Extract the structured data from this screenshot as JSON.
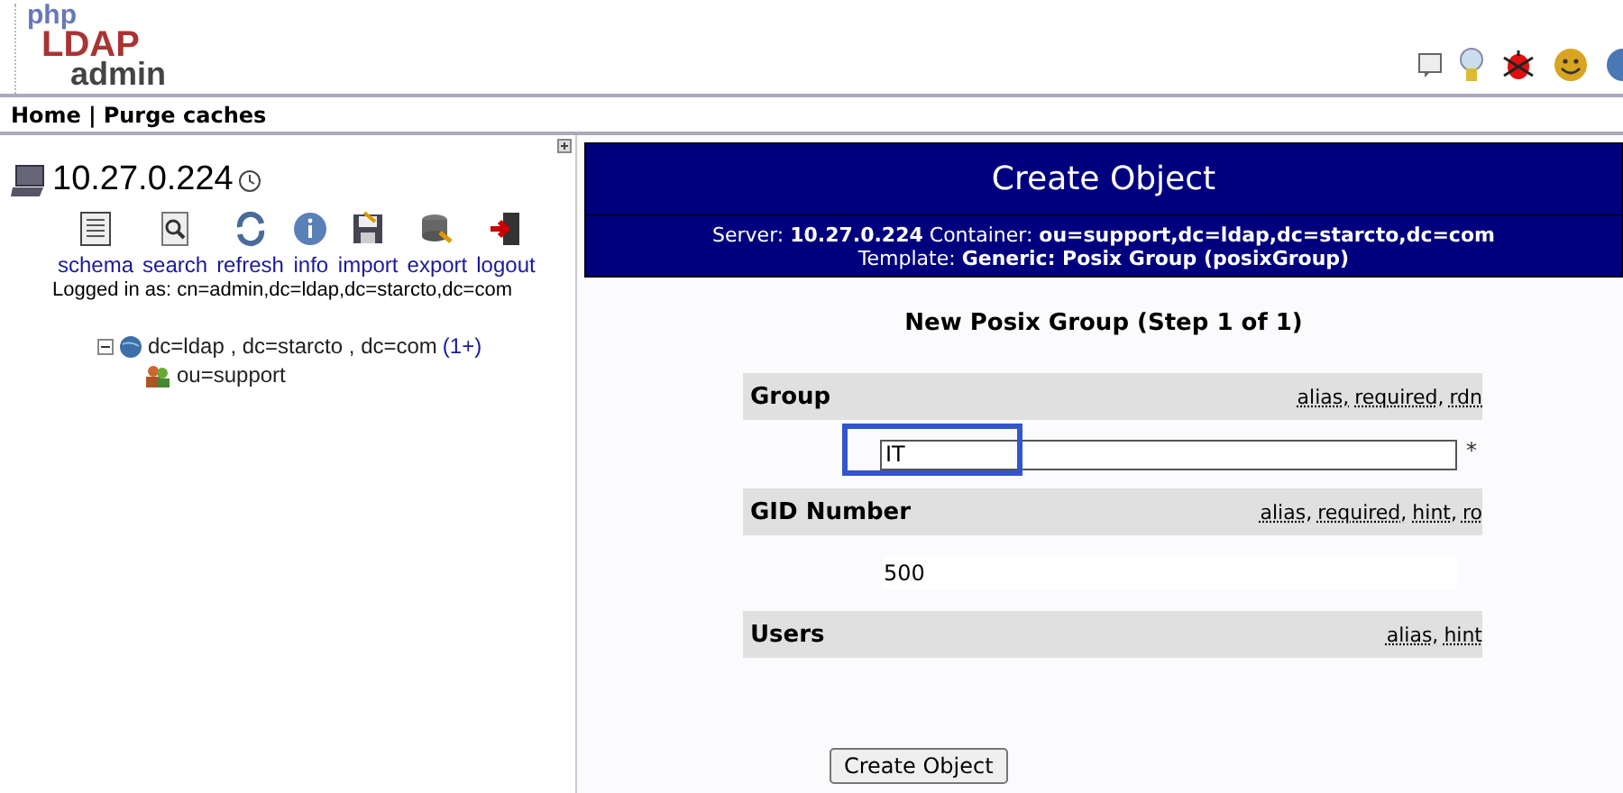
{
  "logo": {
    "line_1": "php",
    "line_2": "LDAP",
    "line_3": "admin"
  },
  "nav": [
    {
      "label": "Home"
    },
    {
      "label": "Purge caches"
    }
  ],
  "nav_separator": "|",
  "server": {
    "name": "10.27.0.224",
    "actions": [
      {
        "label": "schema",
        "kind": "schema"
      },
      {
        "label": "search",
        "kind": "search"
      },
      {
        "label": "refresh",
        "kind": "refresh"
      },
      {
        "label": "info",
        "kind": "info"
      },
      {
        "label": "import",
        "kind": "import"
      },
      {
        "label": "export",
        "kind": "export"
      },
      {
        "label": "logout",
        "kind": "logout"
      }
    ],
    "logged_in": "Logged in as: cn=admin,dc=ldap,dc=starcto,dc=com",
    "tree": [
      {
        "label": "dc=ldap , dc=starcto , dc=com",
        "count": "(1+)",
        "expanded": true,
        "children": [
          {
            "label": "ou=support"
          }
        ]
      }
    ]
  },
  "form": {
    "title": "Create Object",
    "info_line_1": "Server: **10.27.0.224**   Container: **ou=support,dc=ldap,dc=starcto,dc=com**",
    "info_line_2": "Template: **Generic: Posix Group (posixGroup)**",
    "subtitle": "New Posix Group (Step 1 of 1)",
    "attributes": [
      {
        "label": "Group",
        "tags": [
          "alias,",
          "required,",
          "rdn"
        ],
        "kind": "input",
        "value": "IT",
        "required_mark": "*",
        "highlighted": true
      },
      {
        "label": "GID Number",
        "tags": [
          "alias,",
          "required,",
          "hint,",
          "ro"
        ],
        "kind": "readonly",
        "value": "500"
      },
      {
        "label": "Users",
        "tags": [
          "alias,",
          "hint"
        ],
        "kind": "empty"
      }
    ],
    "submit": "Create Object"
  }
}
